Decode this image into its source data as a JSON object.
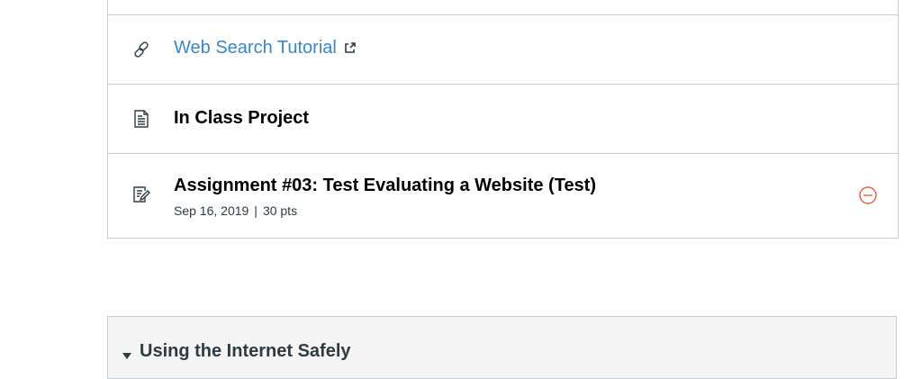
{
  "module": {
    "items": [
      {
        "type": "external-link",
        "icon": "link-icon",
        "title": "Web Search Tutorial",
        "external_icon": "external-link-icon"
      },
      {
        "type": "page",
        "icon": "page-icon",
        "title": "In Class Project"
      },
      {
        "type": "assignment",
        "icon": "quiz-icon",
        "title": "Assignment #03: Test Evaluating a Website (Test)",
        "due_date": "Sep 16, 2019",
        "separator": "|",
        "points": "30 pts",
        "status_icon": "unpublished-icon"
      }
    ]
  },
  "next_module": {
    "caret_icon": "caret-down-icon",
    "title": "Using the Internet Safely"
  },
  "colors": {
    "link": "#3a87c8",
    "unpublished": "#e66135",
    "border": "#c7cdd1",
    "module_header_bg": "#f5f5f5"
  }
}
